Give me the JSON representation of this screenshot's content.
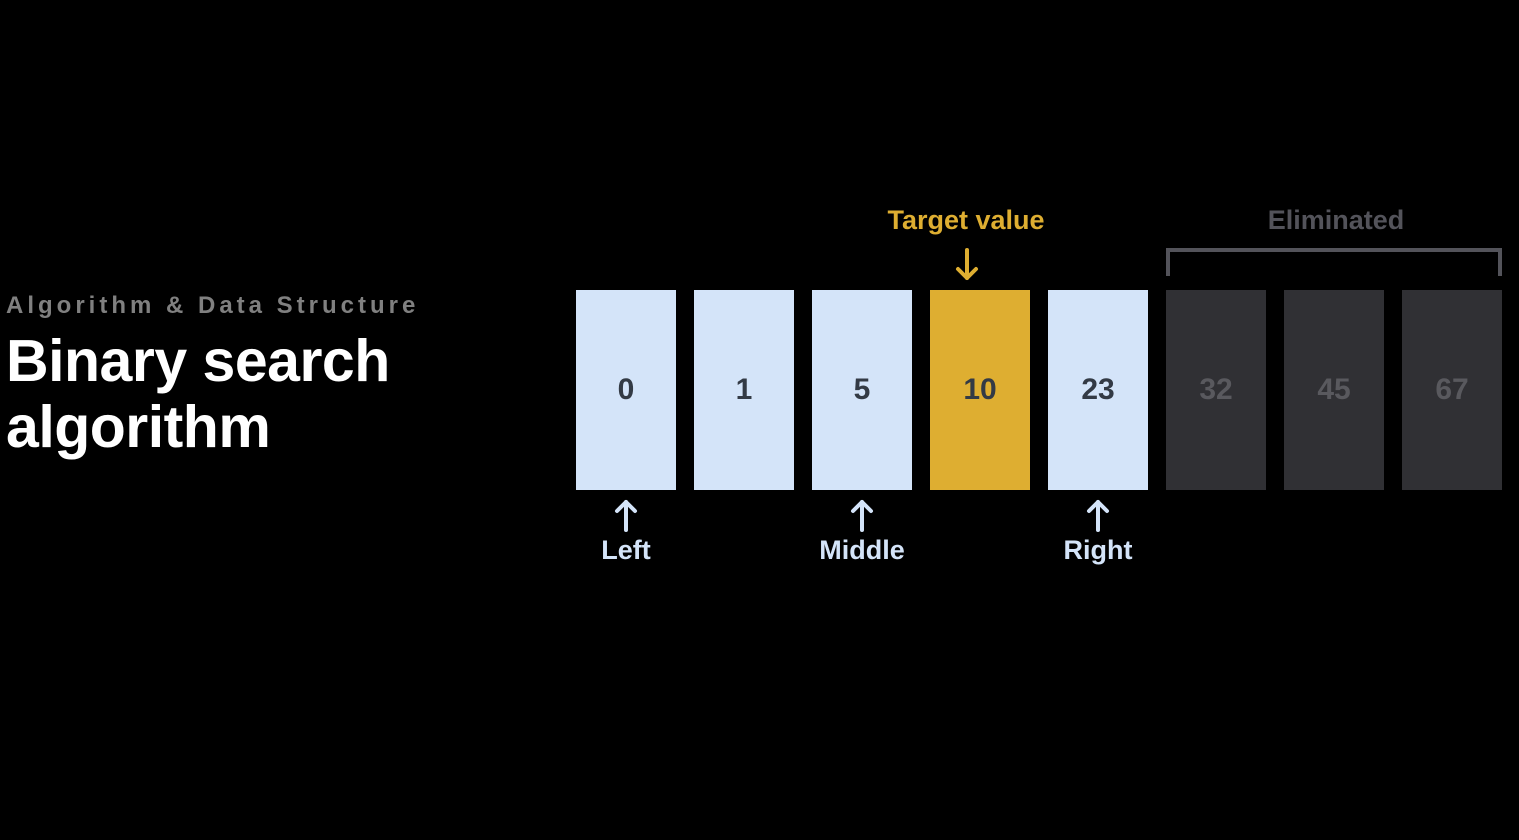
{
  "header": {
    "subtitle": "Algorithm & Data Structure",
    "title": "Binary search algorithm"
  },
  "labels": {
    "target": "Target value",
    "eliminated": "Eliminated",
    "left": "Left",
    "middle": "Middle",
    "right": "Right"
  },
  "cells": [
    {
      "value": "0",
      "state": "active",
      "label": "left"
    },
    {
      "value": "1",
      "state": "active",
      "label": null
    },
    {
      "value": "5",
      "state": "active",
      "label": "middle"
    },
    {
      "value": "10",
      "state": "target",
      "label": null
    },
    {
      "value": "23",
      "state": "active",
      "label": "right"
    },
    {
      "value": "32",
      "state": "eliminated",
      "label": null
    },
    {
      "value": "45",
      "state": "eliminated",
      "label": null
    },
    {
      "value": "67",
      "state": "eliminated",
      "label": null
    }
  ],
  "colors": {
    "background": "#000000",
    "activeCell": "#d4e4f9",
    "targetCell": "#deae31",
    "eliminatedCell": "#303034",
    "textLight": "#ffffff",
    "textMuted": "#808080"
  }
}
